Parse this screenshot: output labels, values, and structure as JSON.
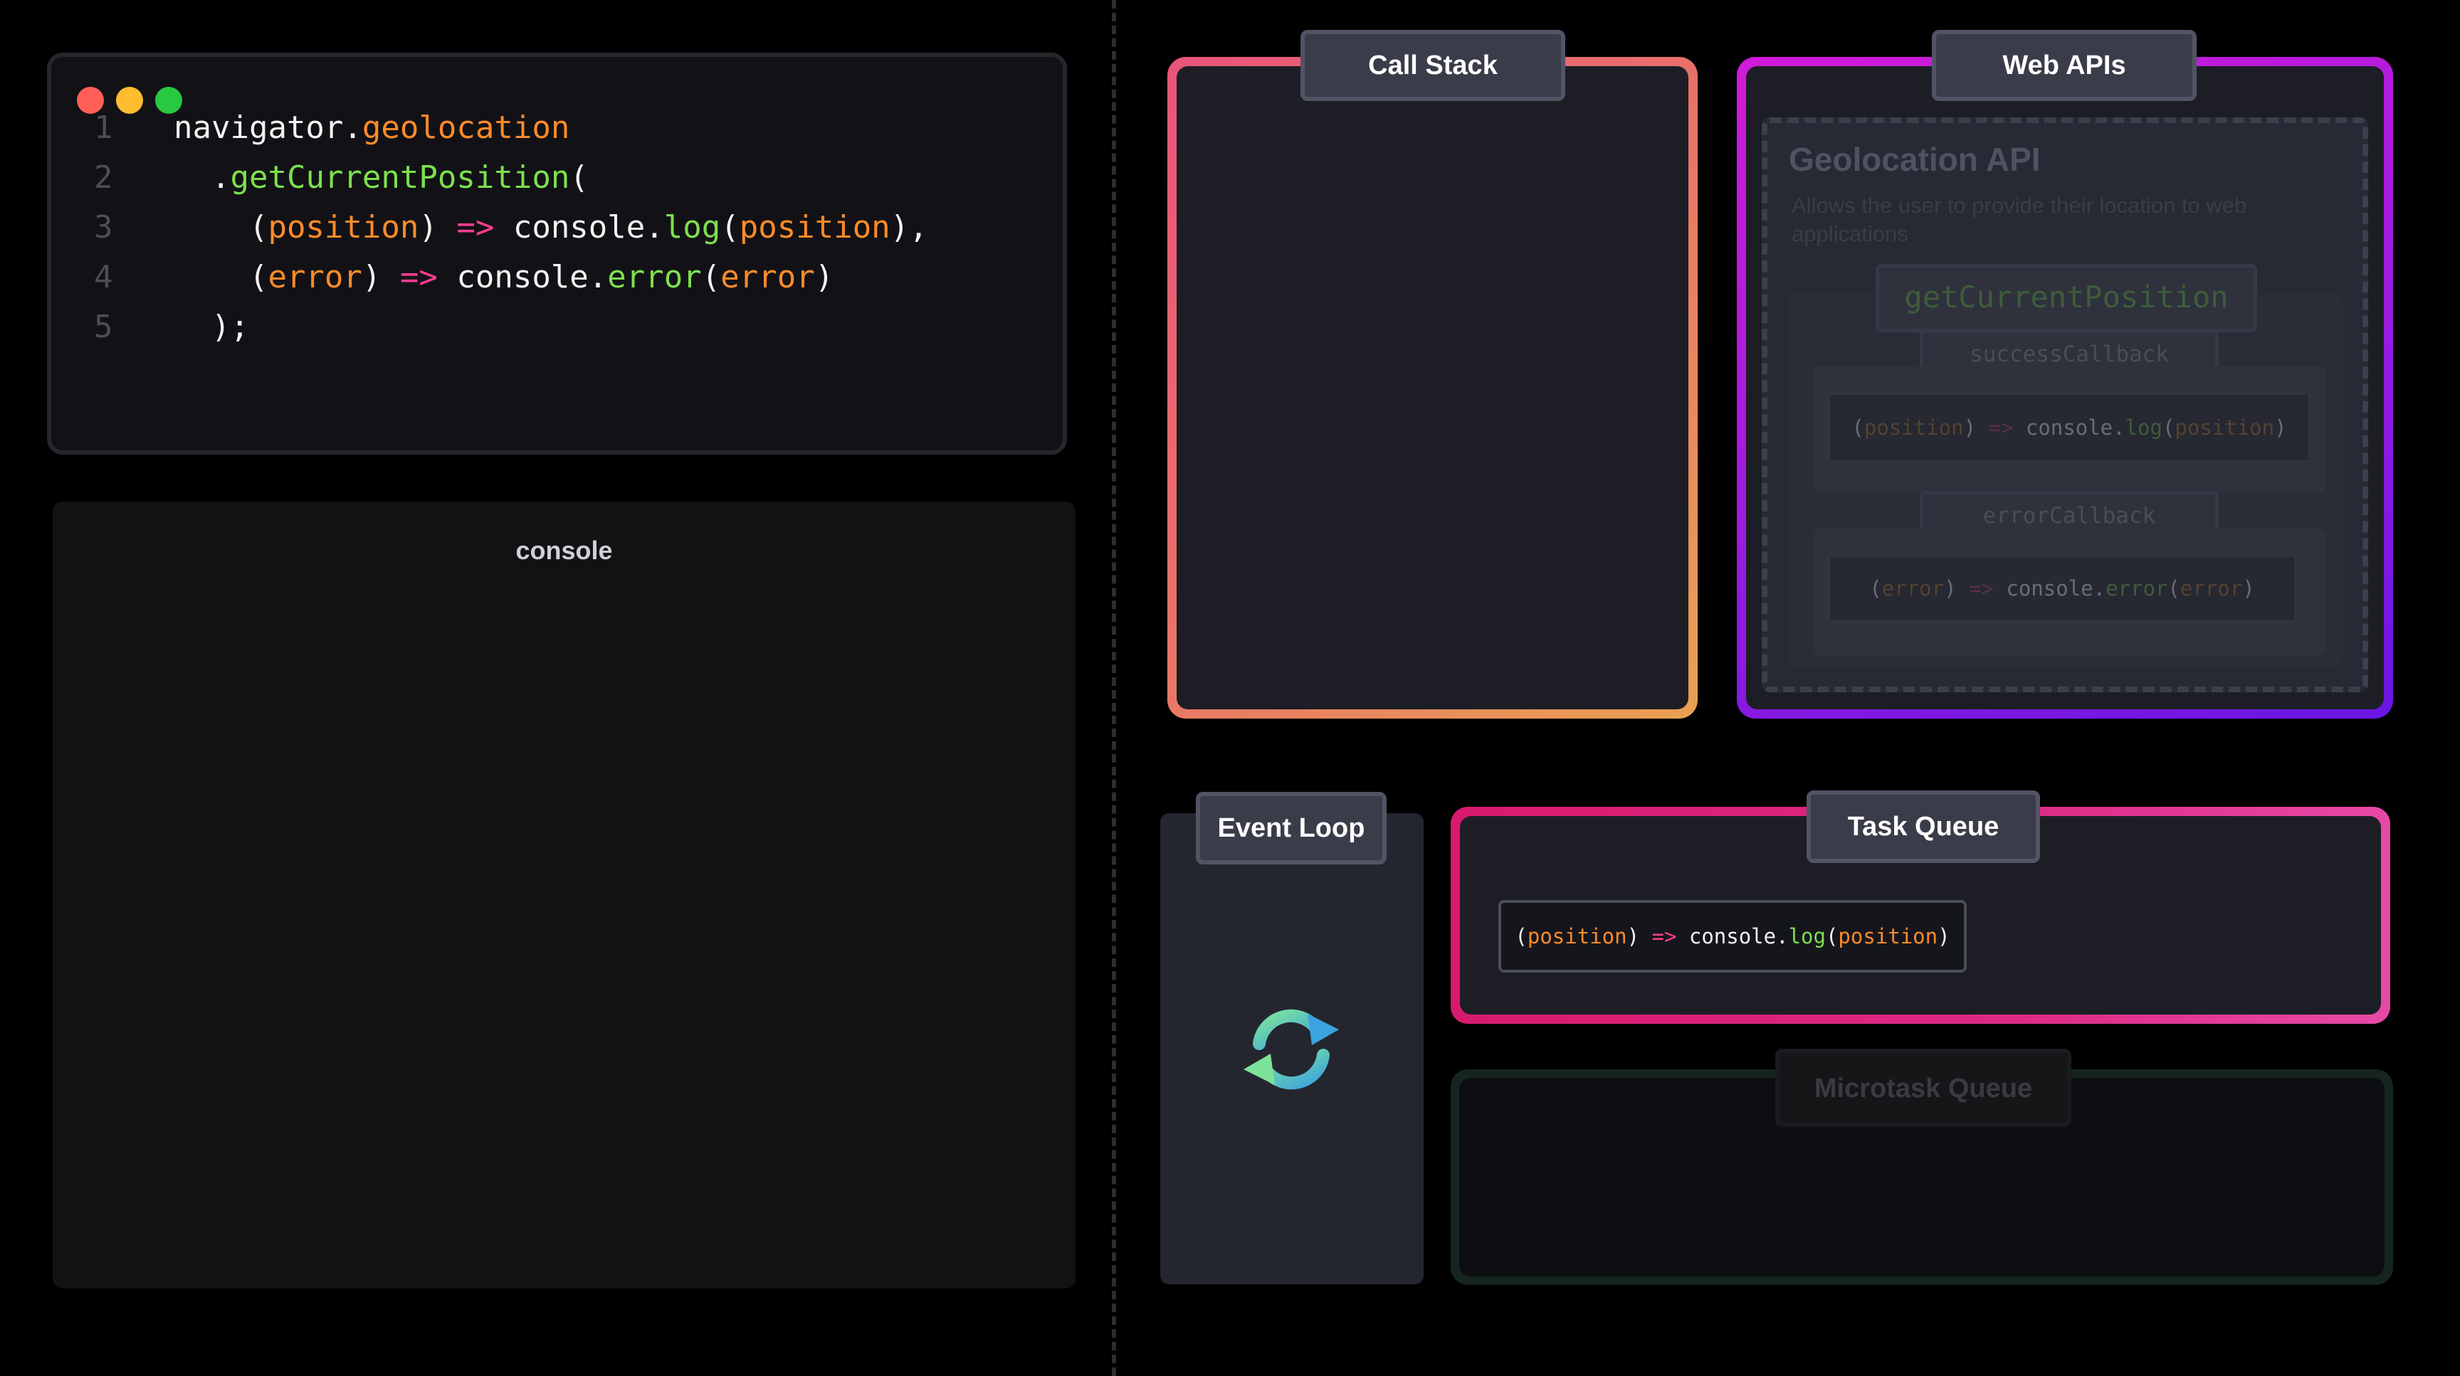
{
  "editor": {
    "window_dots": [
      {
        "name": "close",
        "color": "#ff5f57"
      },
      {
        "name": "minimize",
        "color": "#febc2e"
      },
      {
        "name": "maximize",
        "color": "#28c840"
      }
    ],
    "lines": [
      {
        "number": "1",
        "tokens": [
          {
            "text": "navigator",
            "color": "white"
          },
          {
            "text": ".",
            "color": "white"
          },
          {
            "text": "geolocation",
            "color": "orange"
          }
        ]
      },
      {
        "number": "2",
        "tokens": [
          {
            "text": "  .",
            "color": "white"
          },
          {
            "text": "getCurrentPosition",
            "color": "green"
          },
          {
            "text": "(",
            "color": "white"
          }
        ]
      },
      {
        "number": "3",
        "tokens": [
          {
            "text": "    (",
            "color": "white"
          },
          {
            "text": "position",
            "color": "orange"
          },
          {
            "text": ") ",
            "color": "white"
          },
          {
            "text": "=>",
            "color": "pink"
          },
          {
            "text": " console.",
            "color": "white"
          },
          {
            "text": "log",
            "color": "green"
          },
          {
            "text": "(",
            "color": "white"
          },
          {
            "text": "position",
            "color": "orange"
          },
          {
            "text": "),",
            "color": "white"
          }
        ]
      },
      {
        "number": "4",
        "tokens": [
          {
            "text": "    (",
            "color": "white"
          },
          {
            "text": "error",
            "color": "orange"
          },
          {
            "text": ") ",
            "color": "white"
          },
          {
            "text": "=>",
            "color": "pink"
          },
          {
            "text": " console.",
            "color": "white"
          },
          {
            "text": "error",
            "color": "green"
          },
          {
            "text": "(",
            "color": "white"
          },
          {
            "text": "error",
            "color": "orange"
          },
          {
            "text": ")",
            "color": "white"
          }
        ]
      },
      {
        "number": "5",
        "tokens": [
          {
            "text": "  );",
            "color": "white"
          }
        ]
      }
    ]
  },
  "console": {
    "title": "console"
  },
  "call_stack": {
    "title": "Call Stack"
  },
  "web_apis": {
    "title": "Web APIs",
    "geolocation": {
      "title": "Geolocation API",
      "description": "Allows the user to provide their location to web applications",
      "method": "getCurrentPosition",
      "success_label": "successCallback",
      "success_tokens": [
        {
          "text": "(",
          "color": "white"
        },
        {
          "text": "position",
          "color": "orange"
        },
        {
          "text": ") ",
          "color": "white"
        },
        {
          "text": "=>",
          "color": "pink"
        },
        {
          "text": " console.",
          "color": "white"
        },
        {
          "text": "log",
          "color": "green"
        },
        {
          "text": "(",
          "color": "white"
        },
        {
          "text": "position",
          "color": "orange"
        },
        {
          "text": ")",
          "color": "white"
        }
      ],
      "error_label": "errorCallback",
      "error_tokens": [
        {
          "text": "(",
          "color": "white"
        },
        {
          "text": "error",
          "color": "orange"
        },
        {
          "text": ") ",
          "color": "white"
        },
        {
          "text": "=>",
          "color": "pink"
        },
        {
          "text": " console.",
          "color": "white"
        },
        {
          "text": "error",
          "color": "green"
        },
        {
          "text": "(",
          "color": "white"
        },
        {
          "text": "error",
          "color": "orange"
        },
        {
          "text": ")",
          "color": "white"
        }
      ]
    }
  },
  "event_loop": {
    "title": "Event Loop",
    "icon": "refresh-icon"
  },
  "task_queue": {
    "title": "Task Queue",
    "items": [
      {
        "tokens": [
          {
            "text": "(",
            "color": "white"
          },
          {
            "text": "position",
            "color": "orange"
          },
          {
            "text": ") ",
            "color": "white"
          },
          {
            "text": "=>",
            "color": "pink"
          },
          {
            "text": " console.",
            "color": "white"
          },
          {
            "text": "log",
            "color": "green"
          },
          {
            "text": "(",
            "color": "white"
          },
          {
            "text": "position",
            "color": "orange"
          },
          {
            "text": ")",
            "color": "white"
          }
        ]
      }
    ]
  },
  "microtask_queue": {
    "title": "Microtask Queue"
  },
  "colors": {
    "orange": "#ff8b2a",
    "green": "#7de04e",
    "pink": "#ff3d8f",
    "white": "#f2f2f2",
    "call_stack_border": "#e8706a",
    "web_apis_border": "#a21be0",
    "task_queue_border": "#dd2a85",
    "microtask_border": "#15241f"
  }
}
